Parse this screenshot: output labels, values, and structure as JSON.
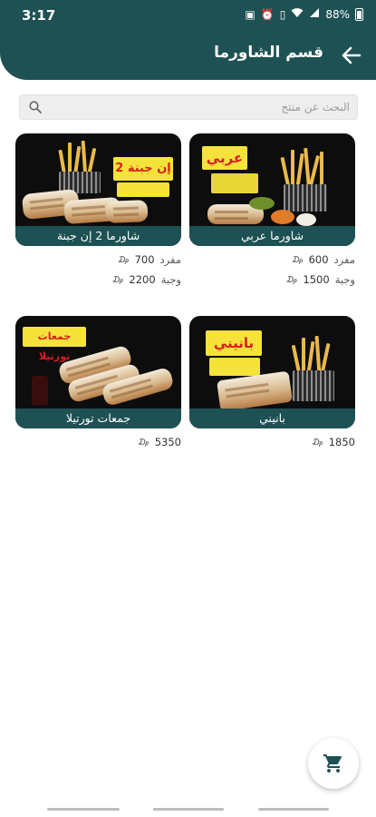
{
  "status_bar": {
    "time": "3:17",
    "battery": "88%",
    "icons": [
      "photo-notification-icon",
      "alarm-icon",
      "vibrate-icon",
      "wifi-icon",
      "signal-icon",
      "battery-icon"
    ]
  },
  "header": {
    "title": "قسم الشاورما",
    "back_icon": "arrow-back-icon"
  },
  "search": {
    "placeholder": "البحث عن منتج",
    "value": ""
  },
  "colors": {
    "primary": "#1e5154",
    "search_bg": "#eeeeee",
    "accent_yellow": "#f5e23a",
    "accent_red": "#d61f1f"
  },
  "products": [
    {
      "name": "شاورما عربي",
      "image_badge": "عربي",
      "prices": [
        {
          "label": "مفرد",
          "value": "600"
        },
        {
          "label": "وجبة",
          "value": "1500"
        }
      ]
    },
    {
      "name": "شاورما 2 إن جبنة",
      "image_badge": "2 إن جبنة",
      "prices": [
        {
          "label": "مفرد",
          "value": "700"
        },
        {
          "label": "وجبة",
          "value": "2200"
        }
      ]
    },
    {
      "name": "بانيني",
      "image_badge": "بانيني",
      "prices": [
        {
          "label": "",
          "value": "1850"
        }
      ]
    },
    {
      "name": "جمعات تورتيلا",
      "image_badge": "جمعات تورتيلا",
      "prices": [
        {
          "label": "",
          "value": "5350"
        }
      ]
    }
  ],
  "currency_symbol": "₯",
  "cart": {
    "icon": "shopping-cart-icon"
  }
}
